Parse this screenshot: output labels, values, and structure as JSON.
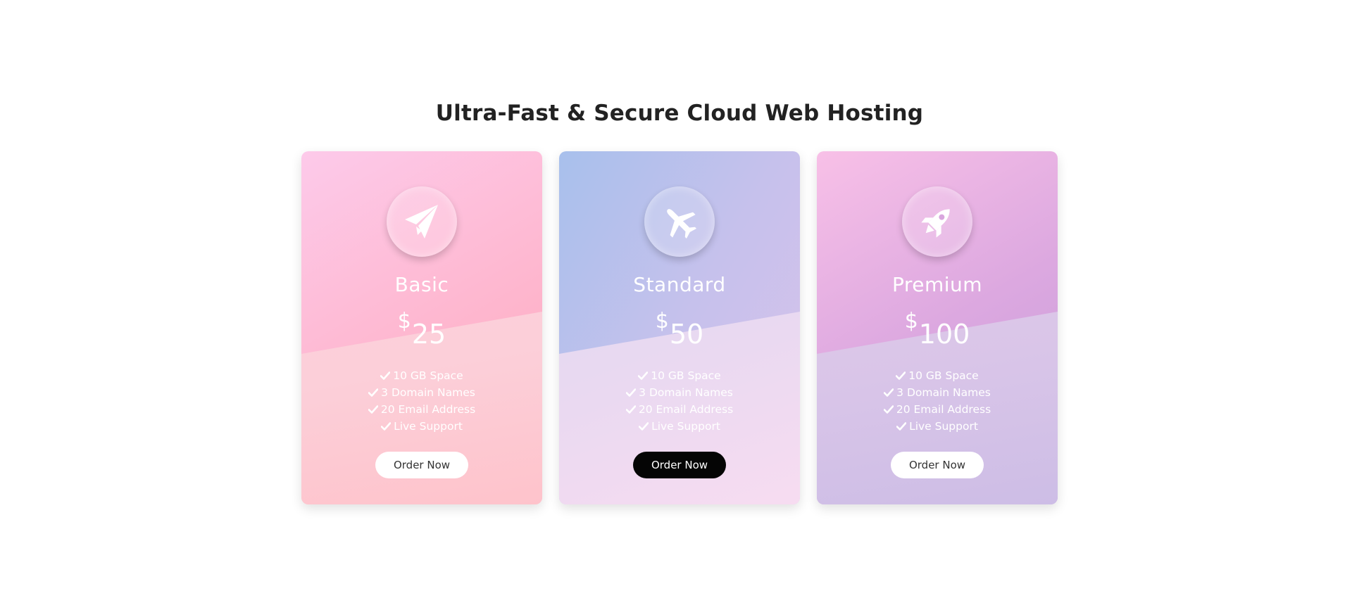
{
  "page": {
    "title": "Ultra-Fast & Secure Cloud Web Hosting"
  },
  "plans": [
    {
      "name": "Basic",
      "icon": "paper-plane-icon",
      "currency": "$",
      "price": "25",
      "features": [
        "10 GB Space",
        "3 Domain Names",
        "20 Email Address",
        "Live Support"
      ],
      "button_label": "Order Now"
    },
    {
      "name": "Standard",
      "icon": "plane-icon",
      "currency": "$",
      "price": "50",
      "features": [
        "10 GB Space",
        "3 Domain Names",
        "20 Email Address",
        "Live Support"
      ],
      "button_label": "Order Now"
    },
    {
      "name": "Premium",
      "icon": "rocket-icon",
      "currency": "$",
      "price": "100",
      "features": [
        "10 GB Space",
        "3 Domain Names",
        "20 Email Address",
        "Live Support"
      ],
      "button_label": "Order Now"
    }
  ],
  "colors": {
    "title": "#222222",
    "basic_accent": "#feb4cb",
    "standard_accent": "#c6c1ec",
    "premium_accent": "#dca8e0",
    "highlight_button": "#050505"
  }
}
